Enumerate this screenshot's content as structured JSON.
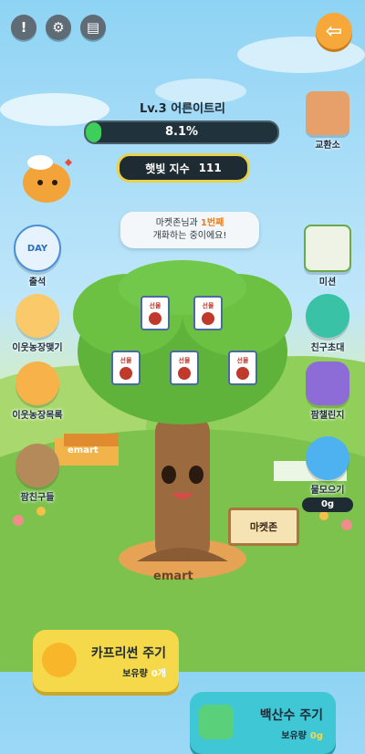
{
  "top_icons": [
    {
      "icon": "!",
      "name": "notice"
    },
    {
      "icon": "⚙",
      "name": "settings"
    },
    {
      "icon": "▤",
      "name": "guide"
    }
  ],
  "back_icon": "⇦",
  "tree": {
    "title": "Lv.3 어른이트리",
    "progress_text": "8.1%",
    "progress_value": 0.081,
    "sunlight_label": "햇빛 지수",
    "sunlight_value": "111"
  },
  "left_menu": [
    {
      "label": "출석",
      "badge": "DAY"
    },
    {
      "label": "이웃농장맺기"
    },
    {
      "label": "이웃농장목록"
    },
    {
      "label": "팜친구들"
    }
  ],
  "right_menu": [
    {
      "label": "교환소"
    },
    {
      "label": "미션"
    },
    {
      "label": "친구초대"
    },
    {
      "label": "팜챌린지"
    },
    {
      "label": "물모으기",
      "value": "0g"
    }
  ],
  "bubble": {
    "line1_a": "마켓존님과 ",
    "line1_b": "1번째",
    "line2": "개화하는 중이에요!"
  },
  "gift_label": "선물",
  "sign_label": "마켓존",
  "ground_brand": "emart",
  "store_brand": "emart",
  "actions": {
    "capri": {
      "title": "카프리썬 주기",
      "sub_label": "보유량",
      "sub_value": "0개"
    },
    "baeksansu": {
      "title": "백산수 주기",
      "sub_label": "보유량",
      "sub_value": "0g"
    }
  },
  "colors": {
    "accent": "#f7a83a",
    "yellow_btn": "#f5d94a",
    "teal_btn": "#3fc7d6"
  }
}
